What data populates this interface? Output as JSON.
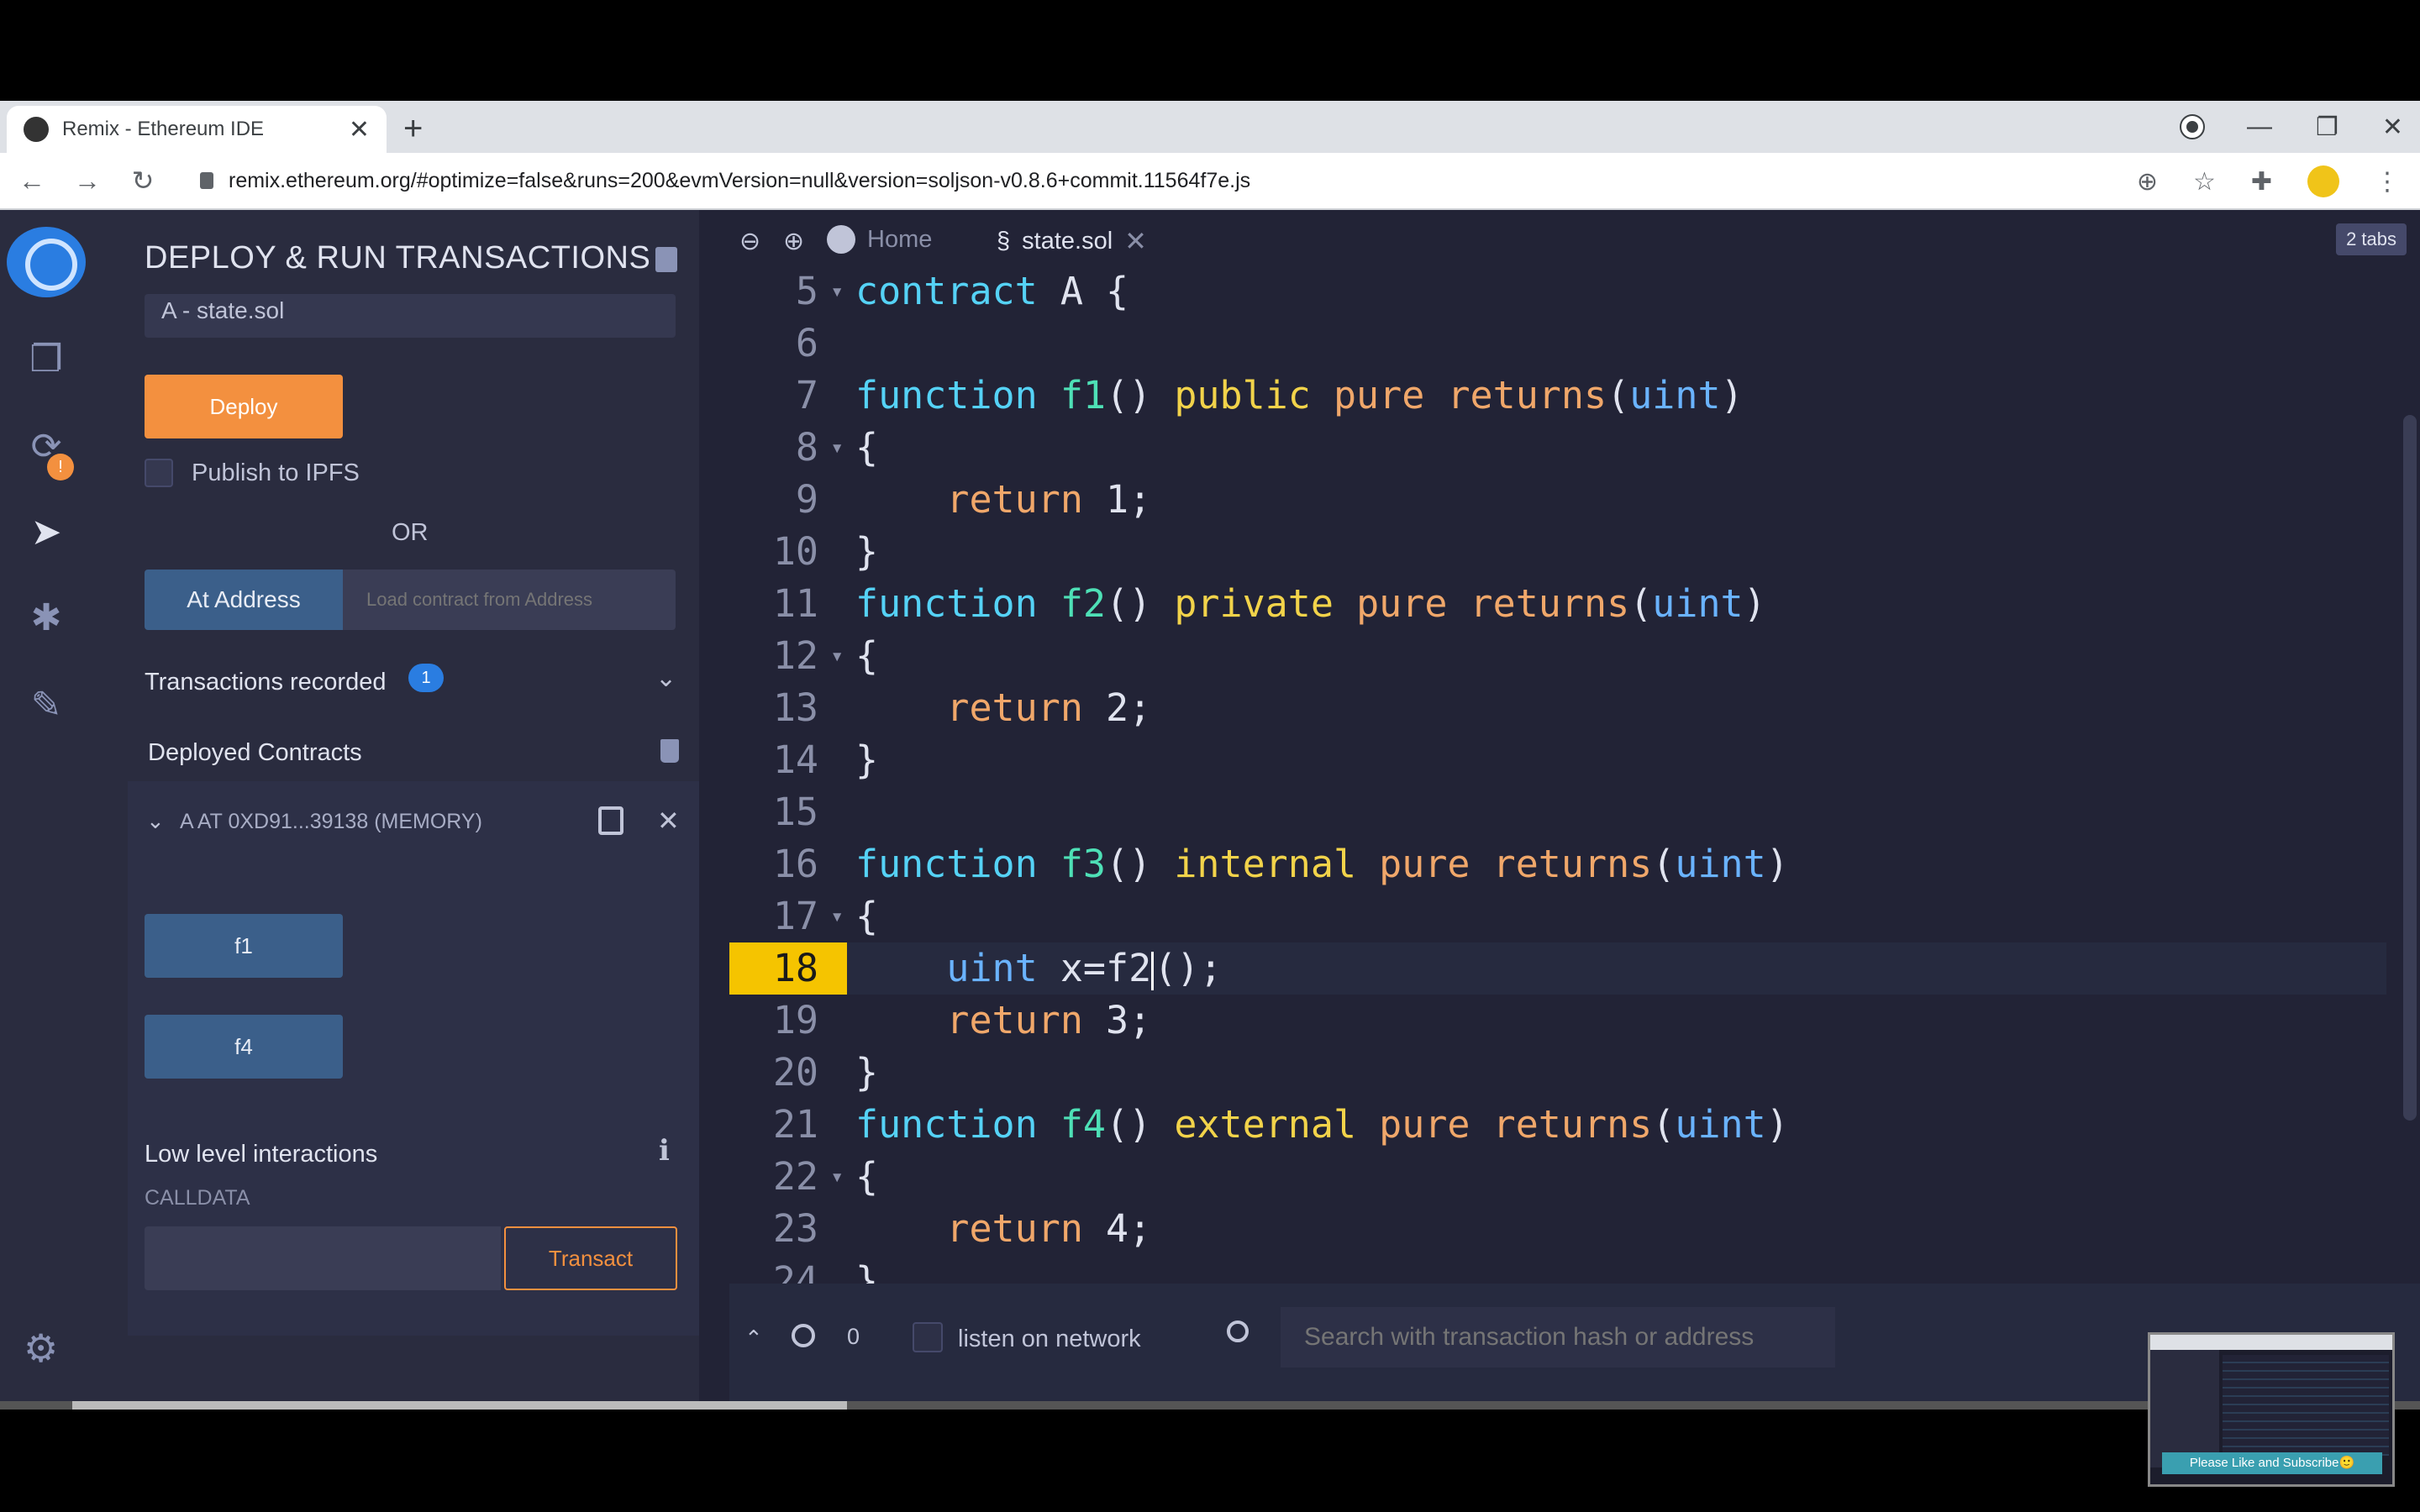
{
  "browser": {
    "tab_title": "Remix - Ethereum IDE",
    "url": "remix.ethereum.org/#optimize=false&runs=200&evmVersion=null&version=soljson-v0.8.6+commit.11564f7e.js"
  },
  "side_panel": {
    "title": "DEPLOY & RUN TRANSACTIONS",
    "contract_select": "A - state.sol",
    "deploy_label": "Deploy",
    "publish_ipfs_label": "Publish to IPFS",
    "or_label": "OR",
    "at_address_label": "At Address",
    "at_address_placeholder": "Load contract from Address",
    "transactions_recorded_label": "Transactions recorded",
    "transactions_recorded_count": "1",
    "deployed_contracts_label": "Deployed Contracts",
    "instance_label": "A AT 0XD91...39138 (MEMORY)",
    "functions": [
      "f1",
      "f4"
    ],
    "low_level_label": "Low level interactions",
    "calldata_label": "CALLDATA",
    "transact_label": "Transact"
  },
  "editor": {
    "home_tab": "Home",
    "file_tab": "state.sol",
    "tabs_count": "2 tabs",
    "current_line": "18",
    "lines": [
      {
        "n": "5",
        "fold": true,
        "t": [
          [
            "kw",
            "contract"
          ],
          [
            "plain",
            " A {"
          ]
        ]
      },
      {
        "n": "6",
        "fold": false,
        "t": []
      },
      {
        "n": "7",
        "fold": false,
        "t": [
          [
            "kw",
            "function"
          ],
          [
            "plain",
            " "
          ],
          [
            "fn",
            "f1"
          ],
          [
            "plain",
            "() "
          ],
          [
            "mod",
            "public"
          ],
          [
            "plain",
            " "
          ],
          [
            "ret",
            "pure"
          ],
          [
            "plain",
            " "
          ],
          [
            "ret",
            "returns"
          ],
          [
            "plain",
            "("
          ],
          [
            "typ",
            "uint"
          ],
          [
            "plain",
            ")"
          ]
        ]
      },
      {
        "n": "8",
        "fold": true,
        "t": [
          [
            "plain",
            "{"
          ]
        ]
      },
      {
        "n": "9",
        "fold": false,
        "t": [
          [
            "plain",
            "    "
          ],
          [
            "ret2",
            "return"
          ],
          [
            "plain",
            " 1;"
          ]
        ]
      },
      {
        "n": "10",
        "fold": false,
        "t": [
          [
            "plain",
            "}"
          ]
        ]
      },
      {
        "n": "11",
        "fold": false,
        "t": [
          [
            "kw",
            "function"
          ],
          [
            "plain",
            " "
          ],
          [
            "fn",
            "f2"
          ],
          [
            "plain",
            "() "
          ],
          [
            "mod",
            "private"
          ],
          [
            "plain",
            " "
          ],
          [
            "ret",
            "pure"
          ],
          [
            "plain",
            " "
          ],
          [
            "ret",
            "returns"
          ],
          [
            "plain",
            "("
          ],
          [
            "typ",
            "uint"
          ],
          [
            "plain",
            ")"
          ]
        ]
      },
      {
        "n": "12",
        "fold": true,
        "t": [
          [
            "plain",
            "{"
          ]
        ]
      },
      {
        "n": "13",
        "fold": false,
        "t": [
          [
            "plain",
            "    "
          ],
          [
            "ret2",
            "return"
          ],
          [
            "plain",
            " 2;"
          ]
        ]
      },
      {
        "n": "14",
        "fold": false,
        "t": [
          [
            "plain",
            "}"
          ]
        ]
      },
      {
        "n": "15",
        "fold": false,
        "t": []
      },
      {
        "n": "16",
        "fold": false,
        "t": [
          [
            "kw",
            "function"
          ],
          [
            "plain",
            " "
          ],
          [
            "fn",
            "f3"
          ],
          [
            "plain",
            "() "
          ],
          [
            "mod",
            "internal"
          ],
          [
            "plain",
            " "
          ],
          [
            "ret",
            "pure"
          ],
          [
            "plain",
            " "
          ],
          [
            "ret",
            "returns"
          ],
          [
            "plain",
            "("
          ],
          [
            "typ",
            "uint"
          ],
          [
            "plain",
            ")"
          ]
        ]
      },
      {
        "n": "17",
        "fold": true,
        "t": [
          [
            "plain",
            "{"
          ]
        ]
      },
      {
        "n": "18",
        "fold": false,
        "t": [
          [
            "plain",
            "    "
          ],
          [
            "typ",
            "uint"
          ],
          [
            "plain",
            " x=f2"
          ],
          [
            "caret",
            ""
          ],
          [
            "plain",
            "();"
          ]
        ]
      },
      {
        "n": "19",
        "fold": false,
        "t": [
          [
            "plain",
            "    "
          ],
          [
            "ret2",
            "return"
          ],
          [
            "plain",
            " 3;"
          ]
        ]
      },
      {
        "n": "20",
        "fold": false,
        "t": [
          [
            "plain",
            "}"
          ]
        ]
      },
      {
        "n": "21",
        "fold": false,
        "t": [
          [
            "kw",
            "function"
          ],
          [
            "plain",
            " "
          ],
          [
            "fn",
            "f4"
          ],
          [
            "plain",
            "() "
          ],
          [
            "mod",
            "external"
          ],
          [
            "plain",
            " "
          ],
          [
            "ret",
            "pure"
          ],
          [
            "plain",
            " "
          ],
          [
            "ret",
            "returns"
          ],
          [
            "plain",
            "("
          ],
          [
            "typ",
            "uint"
          ],
          [
            "plain",
            ")"
          ]
        ]
      },
      {
        "n": "22",
        "fold": true,
        "t": [
          [
            "plain",
            "{"
          ]
        ]
      },
      {
        "n": "23",
        "fold": false,
        "t": [
          [
            "plain",
            "    "
          ],
          [
            "ret2",
            "return"
          ],
          [
            "plain",
            " 4;"
          ]
        ]
      },
      {
        "n": "24",
        "fold": false,
        "t": [
          [
            "plain",
            "}"
          ]
        ]
      }
    ]
  },
  "terminal": {
    "count": "0",
    "listen_label": "listen on network",
    "search_placeholder": "Search with transaction hash or address"
  },
  "video": {
    "thumbnail_caption": "Please Like and Subscribe🙂",
    "buffered_fraction": 0.32
  }
}
